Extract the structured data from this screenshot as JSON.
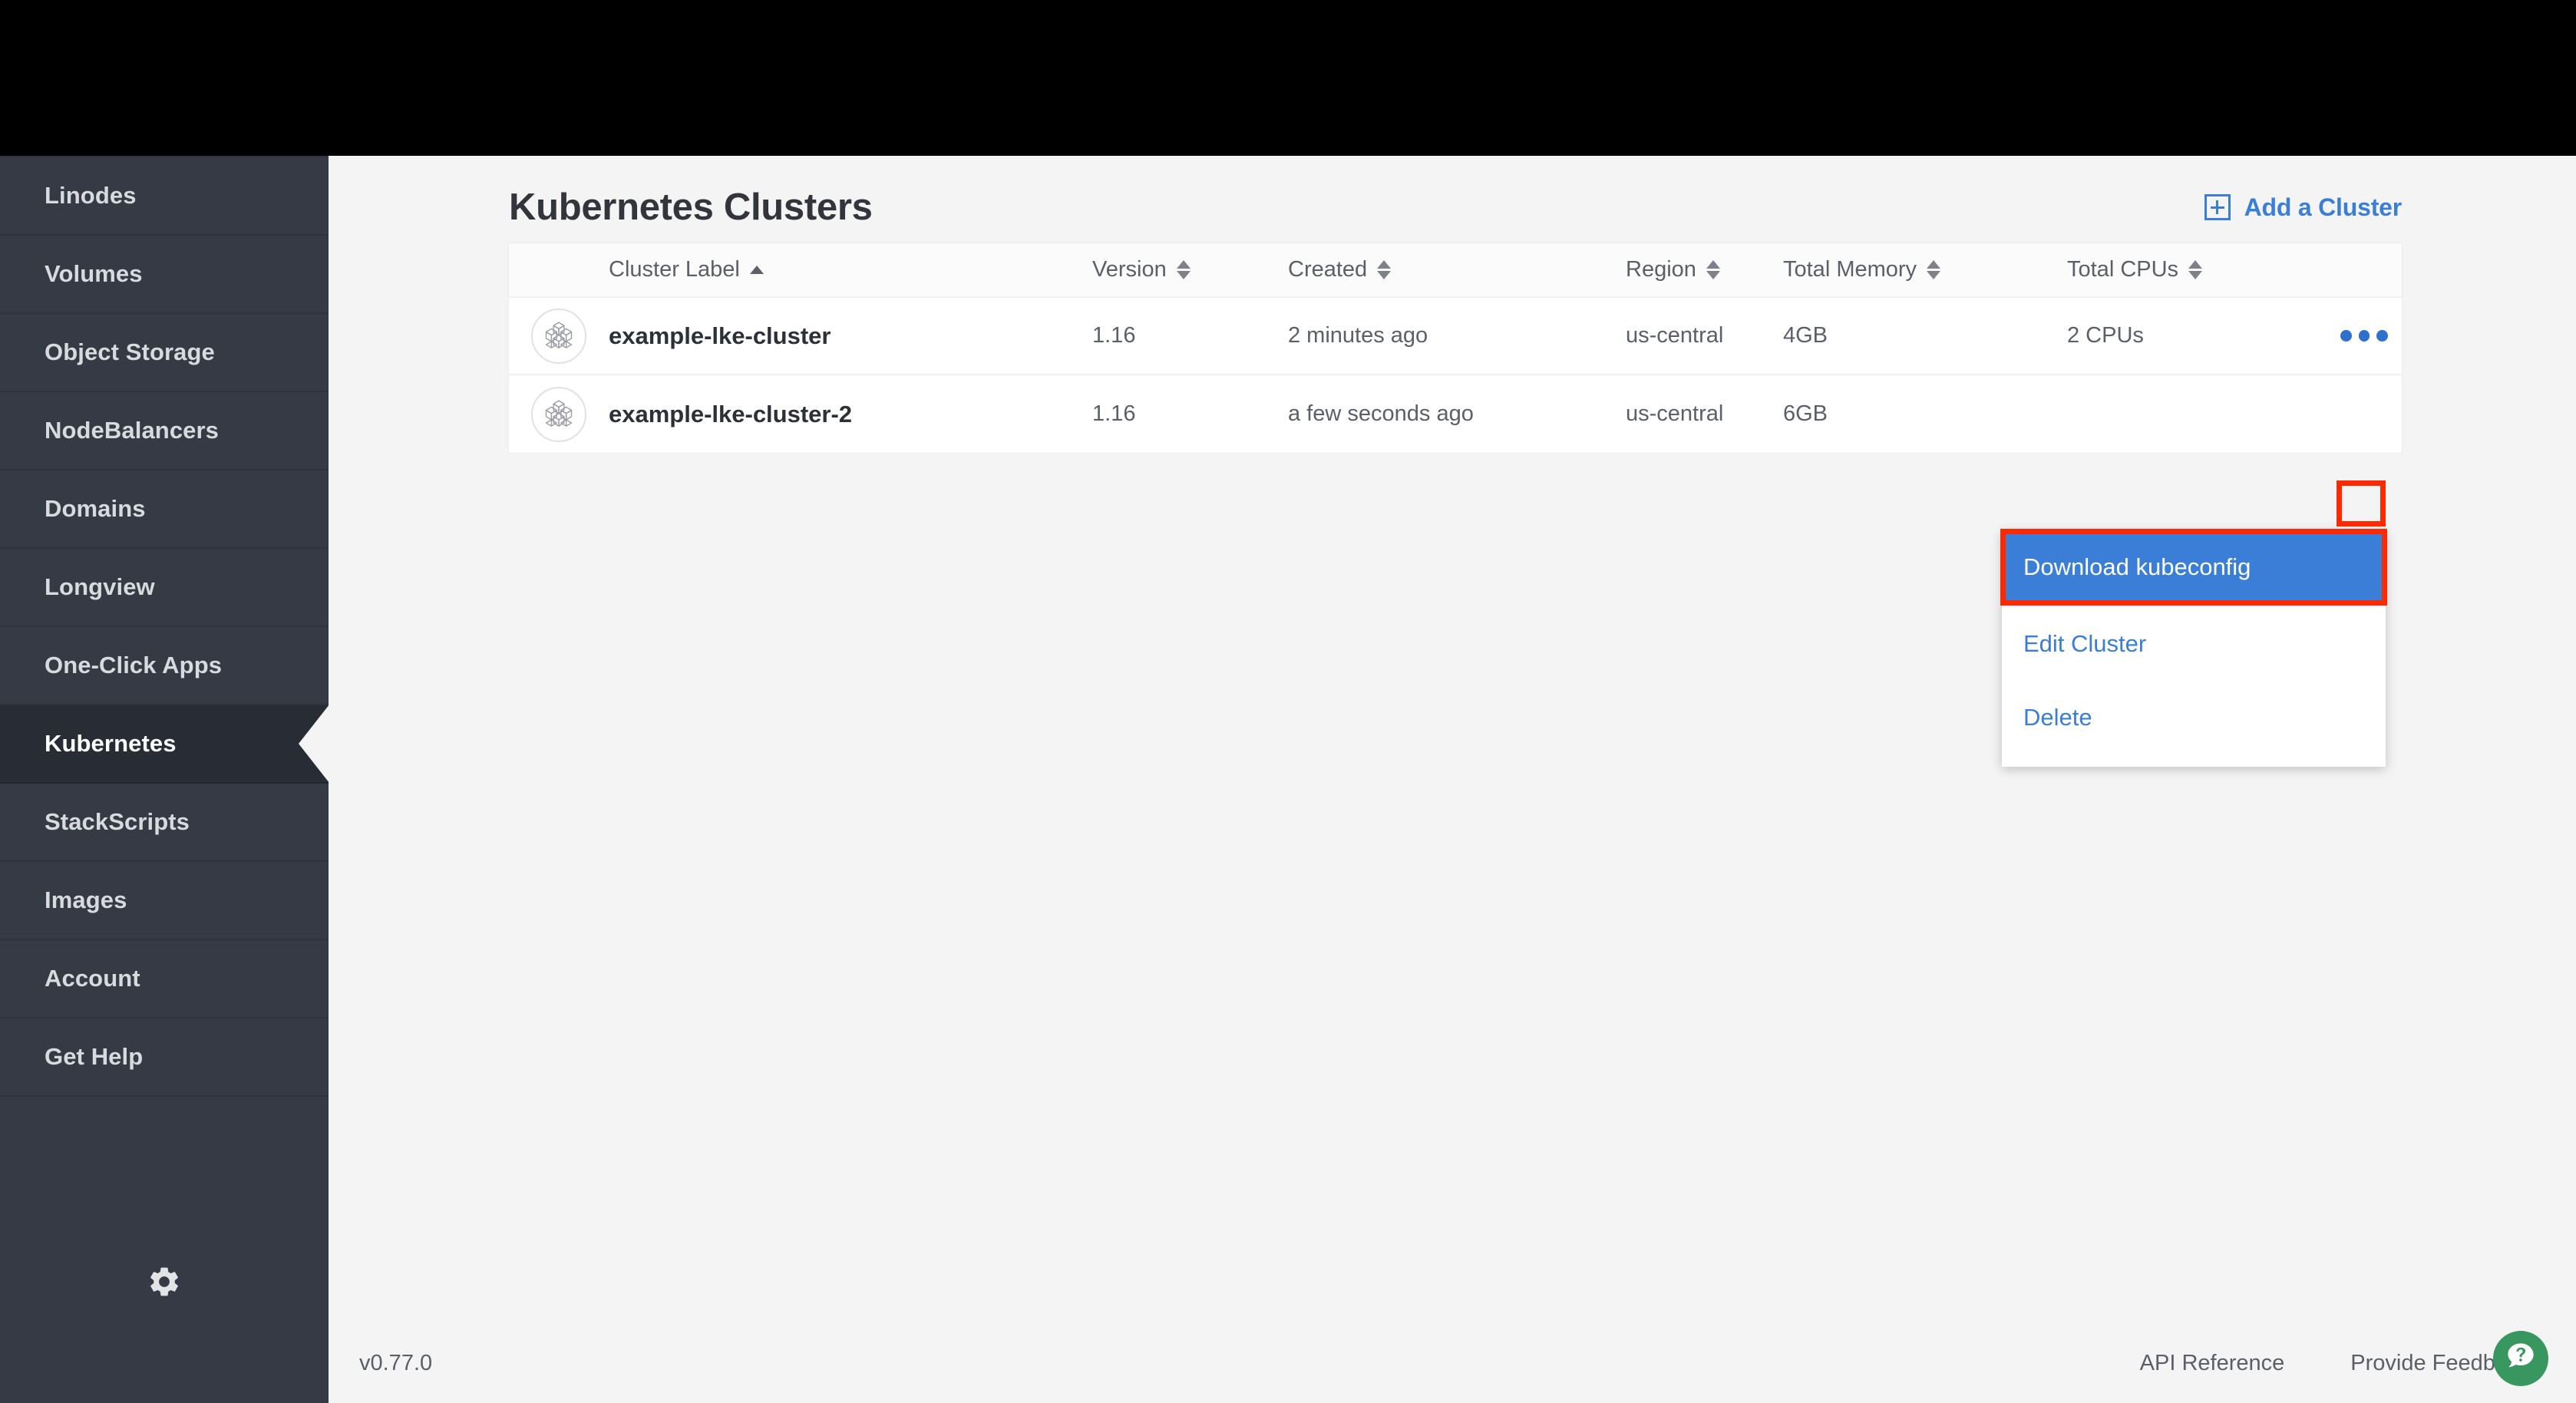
{
  "colors": {
    "accent_blue": "#3a7ed8",
    "sidebar_bg": "#353a45",
    "sidebar_active_bg": "#282c34",
    "content_bg": "#f4f4f5",
    "highlight_red": "#fc2a00",
    "help_green": "#38965f"
  },
  "sidebar": {
    "items": [
      {
        "label": "Linodes",
        "active": false
      },
      {
        "label": "Volumes",
        "active": false
      },
      {
        "label": "Object Storage",
        "active": false
      },
      {
        "label": "NodeBalancers",
        "active": false
      },
      {
        "label": "Domains",
        "active": false
      },
      {
        "label": "Longview",
        "active": false
      },
      {
        "label": "One-Click Apps",
        "active": false
      },
      {
        "label": "Kubernetes",
        "active": true
      },
      {
        "label": "StackScripts",
        "active": false
      },
      {
        "label": "Images",
        "active": false
      },
      {
        "label": "Account",
        "active": false
      },
      {
        "label": "Get Help",
        "active": false
      }
    ],
    "settings_icon": "gear-icon"
  },
  "header": {
    "title": "Kubernetes Clusters",
    "add_cluster_label": "Add a Cluster",
    "add_cluster_icon": "plus-square-icon"
  },
  "table": {
    "columns": [
      {
        "key": "icon",
        "label": "",
        "sort": "none"
      },
      {
        "key": "label",
        "label": "Cluster Label",
        "sort": "asc"
      },
      {
        "key": "version",
        "label": "Version",
        "sort": "none"
      },
      {
        "key": "created",
        "label": "Created",
        "sort": "none"
      },
      {
        "key": "region",
        "label": "Region",
        "sort": "none"
      },
      {
        "key": "memory",
        "label": "Total Memory",
        "sort": "none"
      },
      {
        "key": "cpus",
        "label": "Total CPUs",
        "sort": "none"
      }
    ],
    "rows": [
      {
        "icon": "kubernetes-cluster-icon",
        "label": "example-lke-cluster",
        "version": "1.16",
        "created": "2 minutes ago",
        "region": "us-central",
        "memory": "4GB",
        "cpus": "2 CPUs",
        "actions_icon": "kebab-menu-icon"
      },
      {
        "icon": "kubernetes-cluster-icon",
        "label": "example-lke-cluster-2",
        "version": "1.16",
        "created": "a few seconds ago",
        "region": "us-central",
        "memory": "6GB",
        "cpus": "",
        "actions_icon": "kebab-menu-icon"
      }
    ]
  },
  "action_menu": {
    "items": [
      {
        "label": "Download kubeconfig",
        "highlighted": true
      },
      {
        "label": "Edit Cluster",
        "highlighted": false
      },
      {
        "label": "Delete",
        "highlighted": false
      }
    ]
  },
  "footer": {
    "version": "v0.77.0",
    "links": [
      "API Reference",
      "Provide Feedback"
    ],
    "help_icon": "help-question-icon"
  }
}
